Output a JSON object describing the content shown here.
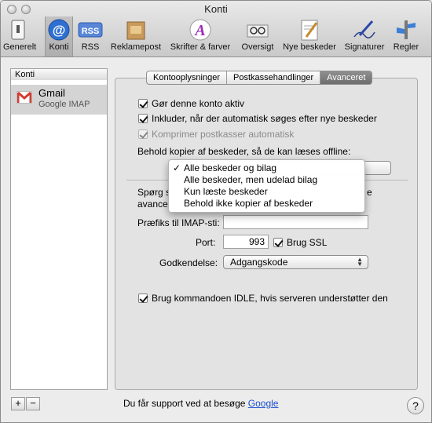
{
  "window": {
    "title": "Konti"
  },
  "toolbar": {
    "items": [
      {
        "label": "Generelt",
        "icon": "switch-icon"
      },
      {
        "label": "Konti",
        "icon": "at-icon",
        "selected": true
      },
      {
        "label": "RSS",
        "icon": "rss-icon"
      },
      {
        "label": "Reklamepost",
        "icon": "trash-bin-icon"
      },
      {
        "label": "Skrifter & farver",
        "icon": "font-color-icon"
      },
      {
        "label": "Oversigt",
        "icon": "glasses-icon"
      },
      {
        "label": "Nye beskeder",
        "icon": "compose-icon"
      },
      {
        "label": "Signaturer",
        "icon": "signature-pen-icon"
      },
      {
        "label": "Regler",
        "icon": "rules-icon"
      }
    ]
  },
  "sidebar": {
    "header": "Konti",
    "accounts": [
      {
        "name": "Gmail",
        "type": "Google IMAP"
      }
    ],
    "add_label": "+",
    "remove_label": "−"
  },
  "tabs": [
    "Kontooplysninger",
    "Postkassehandlinger",
    "Avanceret"
  ],
  "active_tab": "Avanceret",
  "advanced": {
    "enable_account": {
      "label": "Gør denne konto aktiv",
      "checked": true
    },
    "include_auto_check": {
      "label": "Inkluder, når der automatisk søges efter nye beskeder",
      "checked": true
    },
    "compact_mailboxes": {
      "label": "Komprimer postkasser automatisk",
      "checked": true,
      "disabled": true
    },
    "keep_copies_label": "Behold kopier af beskeder, så de kan læses offline:",
    "auth_prompt_prefix": "Spørg s",
    "auth_prompt_prefix2": "avancer",
    "auth_prompt_suffix": "e",
    "prefix_label": "Præfiks til IMAP-sti:",
    "prefix_value": "",
    "port_label": "Port:",
    "port_value": "993",
    "ssl": {
      "label": "Brug SSL",
      "checked": true
    },
    "auth_label": "Godkendelse:",
    "auth_value": "Adgangskode",
    "idle": {
      "label": "Brug kommandoen IDLE, hvis serveren understøtter den",
      "checked": true
    }
  },
  "dropdown": {
    "options": [
      "Alle beskeder og bilag",
      "Alle beskeder, men udelad bilag",
      "Kun læste beskeder",
      "Behold ikke kopier af beskeder"
    ],
    "checkmark": "✓"
  },
  "footer": {
    "support_text": "Du får support ved at besøge",
    "support_link": "Google",
    "help_label": "?"
  }
}
